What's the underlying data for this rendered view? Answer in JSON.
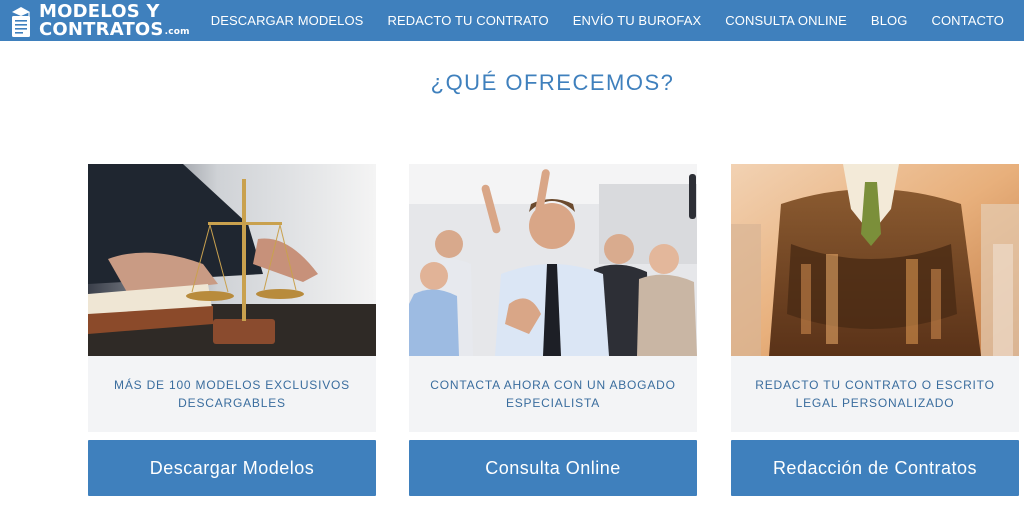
{
  "header": {
    "logo_line1": "MODELOS Y",
    "logo_line2": "CONTRATOS",
    "logo_suffix": ".com",
    "nav": [
      {
        "label": "DESCARGAR MODELOS"
      },
      {
        "label": "REDACTO TU CONTRATO"
      },
      {
        "label": "ENVÍO TU BUROFAX"
      },
      {
        "label": "CONSULTA ONLINE"
      },
      {
        "label": "BLOG"
      },
      {
        "label": "CONTACTO"
      }
    ]
  },
  "section": {
    "title": "¿QUÉ OFRECEMOS?"
  },
  "cards": [
    {
      "caption_line1": "MÁS DE 100 MODELOS EXCLUSIVOS",
      "caption_line2": "DESCARGABLES",
      "button": "Descargar Modelos",
      "image": "scales-of-justice-photo"
    },
    {
      "caption_line1": "CONTACTA AHORA CON UN ABOGADO",
      "caption_line2": "ESPECIALISTA",
      "button": "Consulta Online",
      "image": "celebrating-team-photo"
    },
    {
      "caption_line1": "REDACTO TU CONTRATO O ESCRITO",
      "caption_line2": "LEGAL PERSONALIZADO",
      "button": "Redacción de Contratos",
      "image": "businessman-city-photo"
    }
  ],
  "colors": {
    "brand_blue": "#3f80bd",
    "caption_bg": "#f3f4f6",
    "caption_text": "#3a6d9e"
  }
}
